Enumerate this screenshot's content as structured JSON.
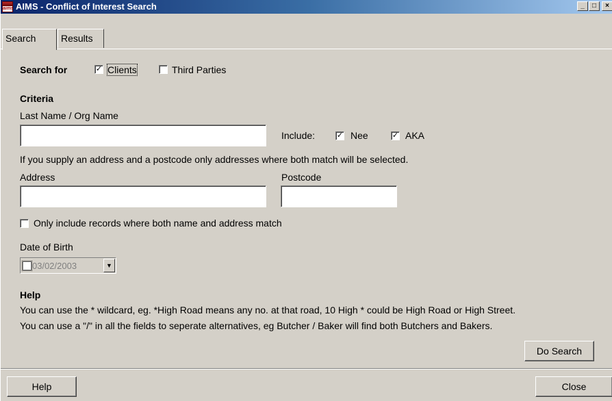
{
  "window": {
    "title": "AIMS - Conflict of Interest Search",
    "icon_text": "aims",
    "controls": {
      "minimize": "_",
      "maximize": "□",
      "close": "×"
    }
  },
  "tabs": [
    {
      "label": "Search"
    },
    {
      "label": "Results"
    }
  ],
  "search_for": {
    "label": "Search for",
    "clients": {
      "label": "Clients",
      "checked": true
    },
    "third_parties": {
      "label": "Third Parties",
      "checked": false
    }
  },
  "criteria": {
    "heading": "Criteria",
    "name_label": "Last Name / Org Name",
    "name_value": "",
    "include_label": "Include:",
    "nee": {
      "label": "Nee",
      "checked": true
    },
    "aka": {
      "label": "AKA",
      "checked": true
    },
    "address_note": "If you supply an address and a postcode only addresses where both match will be selected.",
    "address_label": "Address",
    "address_value": "",
    "postcode_label": "Postcode",
    "postcode_value": "",
    "both_match": {
      "label": "Only include records where both name and address match",
      "checked": false
    },
    "dob_label": "Date of Birth",
    "dob_value": "03/02/2003",
    "dob_enabled": false
  },
  "help": {
    "heading": "Help",
    "line1": "You can use the * wildcard, eg. *High Road means any no. at that road, 10 High * could be High Road or High Street.",
    "line2": "You can use a \"/\" in all the fields to seperate alternatives, eg Butcher / Baker will find both Butchers and Bakers."
  },
  "buttons": {
    "do_search": "Do Search",
    "help": "Help",
    "close": "Close"
  }
}
